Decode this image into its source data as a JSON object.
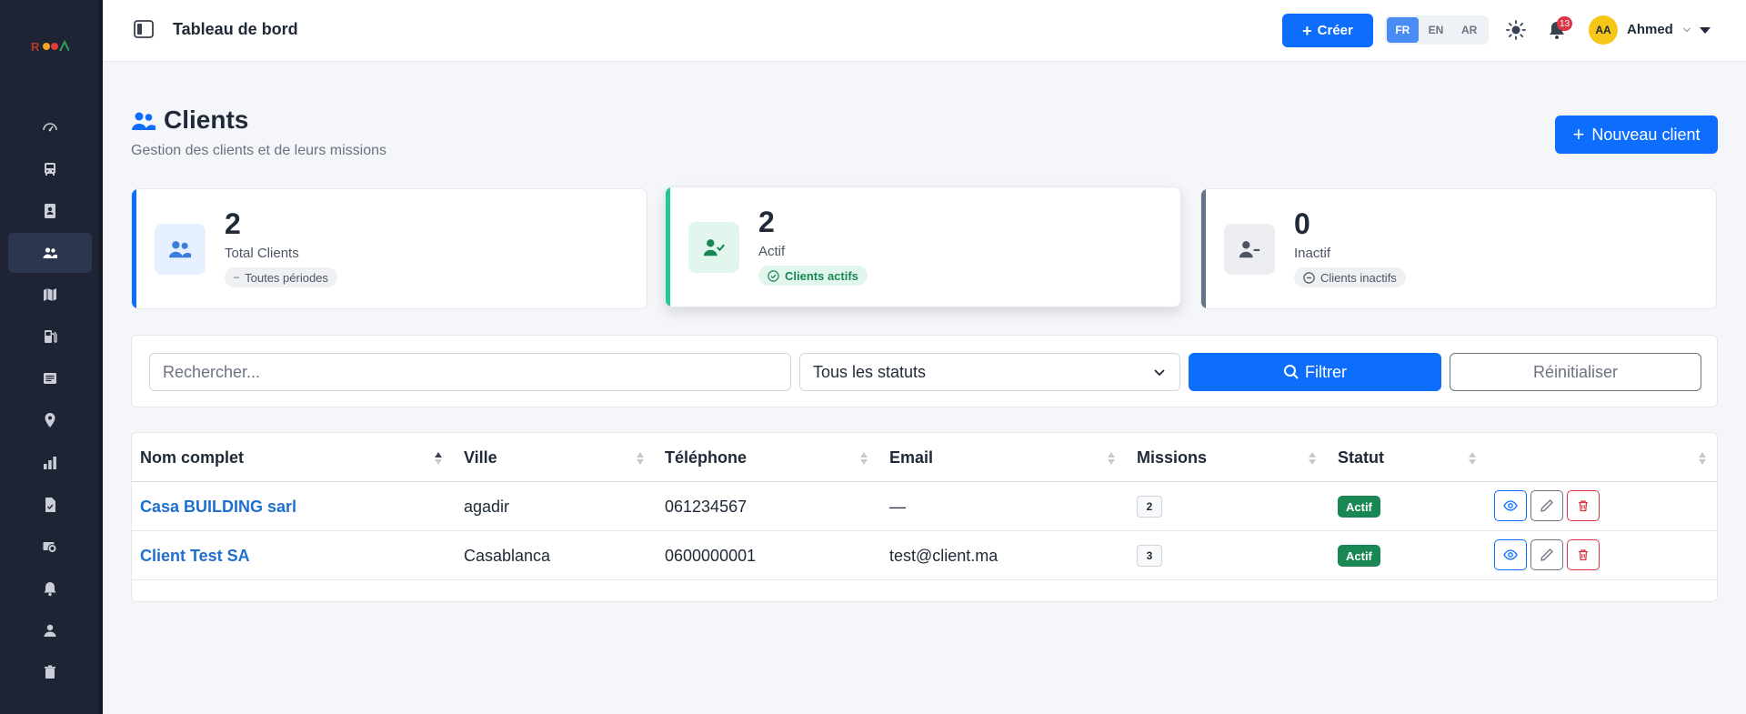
{
  "sidebar": {
    "logo_alt": "logo",
    "items": [
      {
        "icon": "dashboard-gauge-icon"
      },
      {
        "icon": "bus-icon"
      },
      {
        "icon": "contact-card-icon"
      },
      {
        "icon": "users-icon",
        "active": true
      },
      {
        "icon": "map-icon"
      },
      {
        "icon": "fuel-pump-icon"
      },
      {
        "icon": "list-card-icon"
      },
      {
        "icon": "location-pin-icon"
      },
      {
        "icon": "bar-chart-icon"
      },
      {
        "icon": "file-check-icon"
      },
      {
        "icon": "cash-icon"
      },
      {
        "icon": "bell-icon"
      },
      {
        "icon": "person-icon"
      },
      {
        "icon": "trash-icon"
      }
    ]
  },
  "topbar": {
    "title": "Tableau de bord",
    "create_label": "Créer",
    "languages": [
      "FR",
      "EN",
      "AR"
    ],
    "active_language": "FR",
    "notification_count": "13",
    "user_initials": "AA",
    "user_name": "Ahmed"
  },
  "header": {
    "title": "Clients",
    "subtitle": "Gestion des clients et de leurs missions",
    "new_client_label": "Nouveau client"
  },
  "stats": [
    {
      "value": "2",
      "label": "Total Clients",
      "pill": "Toutes périodes",
      "accent": "#0d6efd"
    },
    {
      "value": "2",
      "label": "Actif",
      "pill": "Clients actifs",
      "accent": "#20c997"
    },
    {
      "value": "0",
      "label": "Inactif",
      "pill": "Clients inactifs",
      "accent": "#64748b"
    }
  ],
  "filters": {
    "search_placeholder": "Rechercher...",
    "status_value": "Tous les statuts",
    "filter_label": "Filtrer",
    "reset_label": "Réinitialiser"
  },
  "table": {
    "columns": [
      "Nom complet",
      "Ville",
      "Téléphone",
      "Email",
      "Missions",
      "Statut"
    ],
    "rows": [
      {
        "name": "Casa BUILDING sarl",
        "city": "agadir",
        "phone": "061234567",
        "email": "—",
        "missions": "2",
        "status": "Actif"
      },
      {
        "name": "Client Test SA",
        "city": "Casablanca",
        "phone": "0600000001",
        "email": "test@client.ma",
        "missions": "3",
        "status": "Actif"
      }
    ]
  },
  "colors": {
    "primary": "#0d6efd",
    "sidebar_bg": "#1e2433",
    "success": "#198754",
    "danger": "#dc3545"
  }
}
